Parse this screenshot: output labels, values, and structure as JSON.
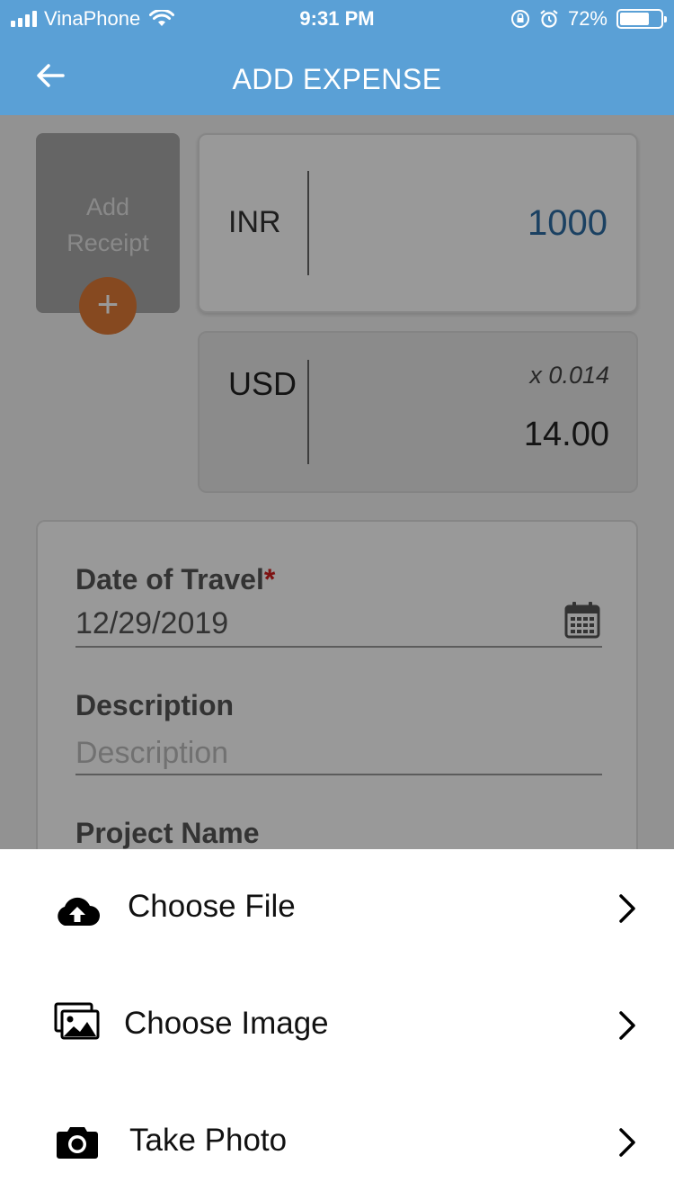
{
  "status_bar": {
    "carrier": "VinaPhone",
    "time": "9:31 PM",
    "battery": "72%",
    "battery_level": 0.72
  },
  "header": {
    "title": "ADD EXPENSE",
    "back_icon": "arrow-left-icon"
  },
  "receipt": {
    "label": "Add Receipt",
    "plus": "+"
  },
  "amount": {
    "currency": "INR",
    "value": "1000"
  },
  "converted": {
    "currency": "USD",
    "rate": "x 0.014",
    "value": "14.00"
  },
  "form": {
    "date_label": "Date of Travel",
    "required_mark": "*",
    "date_value": "12/29/2019",
    "description_label": "Description",
    "description_placeholder": "Description",
    "project_label": "Project Name"
  },
  "sheet": {
    "items": [
      {
        "label": "Choose File",
        "icon": "cloud-upload-icon"
      },
      {
        "label": "Choose Image",
        "icon": "images-icon"
      },
      {
        "label": "Take Photo",
        "icon": "camera-icon"
      }
    ]
  },
  "colors": {
    "header": "#5aa0d6",
    "amount": "#2e6da4",
    "receipt_plus": "#e07a36",
    "required": "#d21f1f"
  }
}
